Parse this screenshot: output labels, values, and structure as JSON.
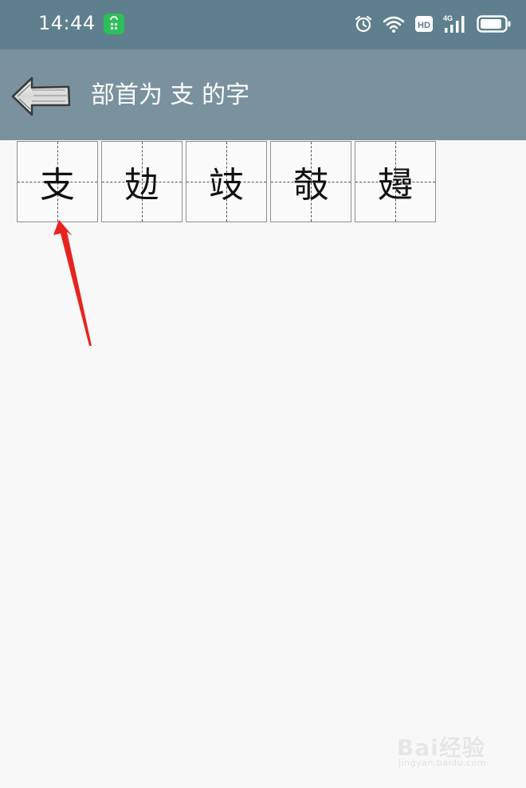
{
  "status_bar": {
    "time": "14:44",
    "network": "4G",
    "hd_label": "HD",
    "icons": [
      "app-store-icon",
      "alarm-icon",
      "wifi-icon",
      "hd-icon",
      "signal-icon",
      "battery-icon"
    ]
  },
  "header": {
    "title": "部首为 支 的字",
    "back_icon": "back-arrow-icon"
  },
  "characters": [
    "支",
    "攰",
    "攱",
    "攲",
    "攳"
  ],
  "annotation": {
    "type": "red-arrow",
    "points_to": "支",
    "color": "#e8231f"
  },
  "watermark": {
    "brand": "Bai经验",
    "url": "jingyan.baidu.com"
  },
  "colors": {
    "status_bar": "#5e7f8d",
    "app_bar": "#7a929e",
    "background": "#f8f8f8",
    "arrow": "#e8231f",
    "app_badge": "#2dbf5a"
  }
}
